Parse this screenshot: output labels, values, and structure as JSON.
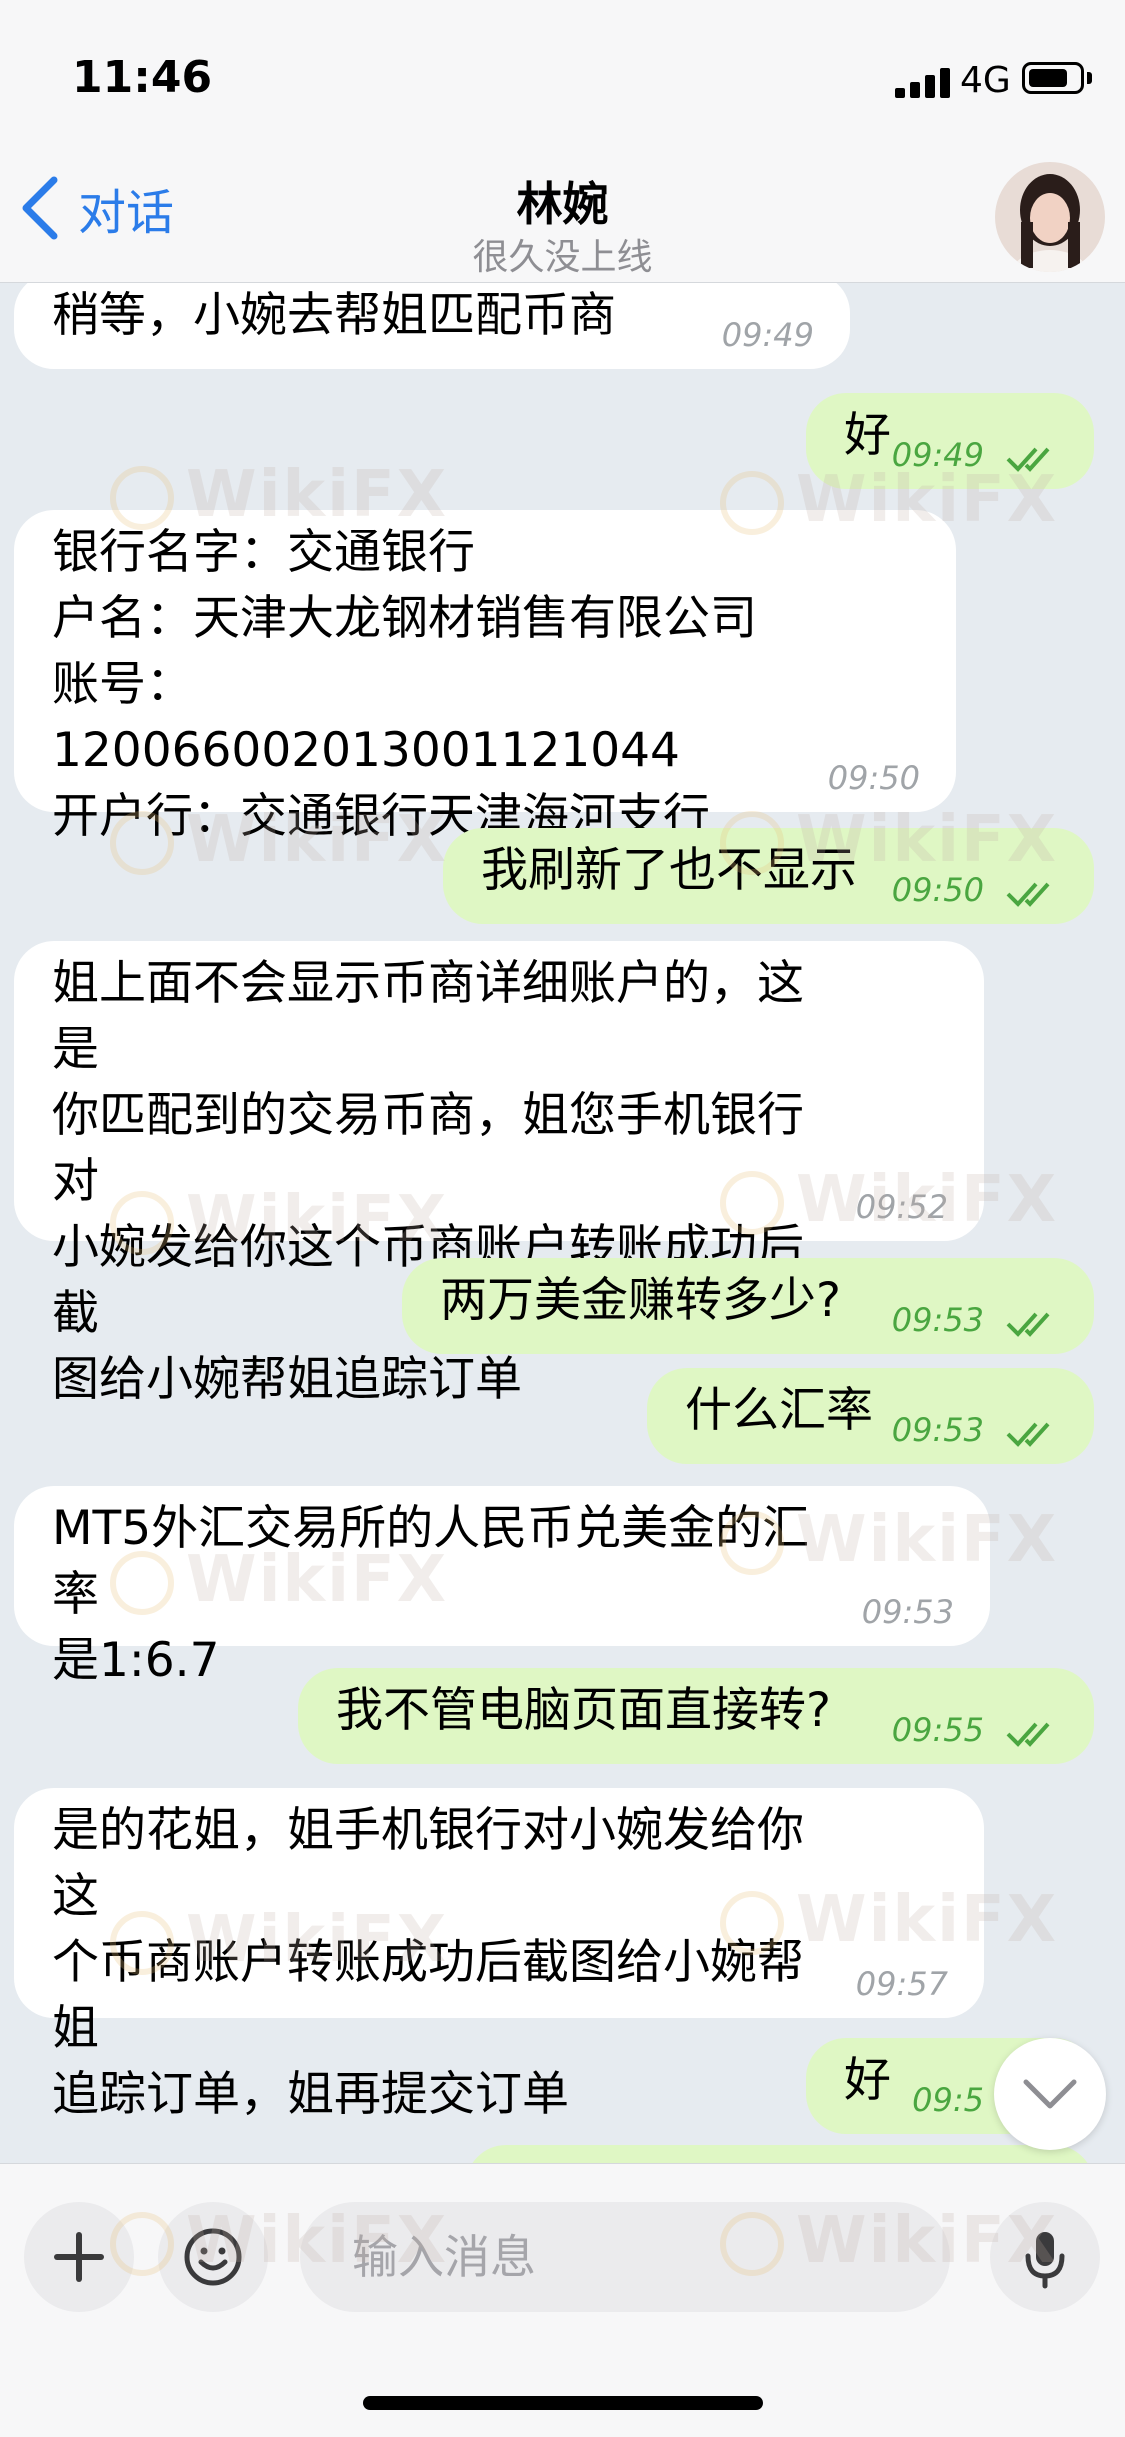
{
  "status": {
    "time": "11:46",
    "network": "4G"
  },
  "header": {
    "back_label": "对话",
    "title": "林婉",
    "subtitle": "很久没上线"
  },
  "messages": [
    {
      "dir": "in",
      "text": "稍等，小婉去帮姐匹配币商",
      "time": "09:49"
    },
    {
      "dir": "out",
      "text": "好",
      "time": "09:49"
    },
    {
      "dir": "in",
      "text": "银行名字：交通银行\n户名：天津大龙钢材销售有限公司\n账号：120066002013001121044\n开户行：交通银行天津海河支行",
      "time": "09:50"
    },
    {
      "dir": "out",
      "text": "我刷新了也不显示",
      "time": "09:50"
    },
    {
      "dir": "in",
      "text": "姐上面不会显示币商详细账户的，这是\n你匹配到的交易币商，姐您手机银行对\n小婉发给你这个币商账户转账成功后截\n图给小婉帮姐追踪订单",
      "time": "09:52"
    },
    {
      "dir": "out",
      "text": "两万美金赚转多少?",
      "time": "09:53"
    },
    {
      "dir": "out",
      "text": "什么汇率",
      "time": "09:53"
    },
    {
      "dir": "in",
      "text": "MT5外汇交易所的人民币兑美金的汇率\n是1:6.7",
      "time": "09:53"
    },
    {
      "dir": "out",
      "text": "我不管电脑页面直接转?",
      "time": "09:55"
    },
    {
      "dir": "in",
      "text": "是的花姐，姐手机银行对小婉发给你这\n个币商账户转账成功后截图给小婉帮姐\n追踪订单，姐再提交订单",
      "time": "09:57"
    },
    {
      "dir": "out",
      "text": "好",
      "time": "09:5"
    }
  ],
  "composer": {
    "placeholder": "输入消息"
  },
  "watermark": {
    "text": "WikiFX"
  },
  "colors": {
    "accent": "#2b7ce9",
    "outgoing_bubble": "#dff7c4",
    "incoming_bubble": "#ffffff",
    "read_tick": "#4aa640"
  }
}
